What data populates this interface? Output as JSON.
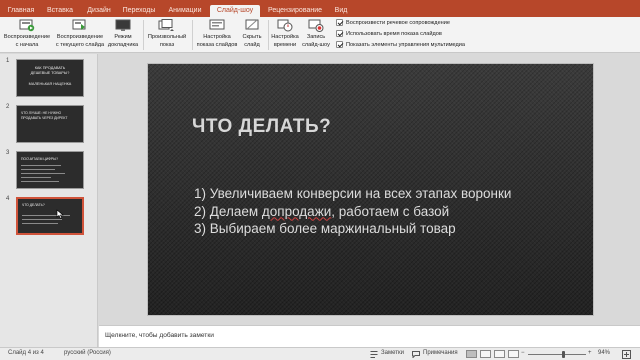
{
  "tabs": [
    "Главная",
    "Вставка",
    "Дизайн",
    "Переходы",
    "Анимации",
    "Слайд-шоу",
    "Рецензирование",
    "Вид"
  ],
  "active_tab": "Слайд-шоу",
  "ribbon": {
    "play_from_start": [
      "Воспроизведение",
      "с начала"
    ],
    "play_from_current": [
      "Воспроизведение",
      "с текущего слайда"
    ],
    "presenter_view": [
      "Режим",
      "докладчика"
    ],
    "custom_show": [
      "Произвольный",
      "показ"
    ],
    "setup_show": [
      "Настройка",
      "показа слайдов"
    ],
    "hide_slide": [
      "Скрыть",
      "слайд"
    ],
    "rehearse_timings": [
      "Настройка",
      "времени"
    ],
    "record_show": [
      "Запись",
      "слайд-шоу"
    ],
    "checkboxes": [
      {
        "label": "Воспроизвести речевое сопровождение",
        "checked": true
      },
      {
        "label": "Использовать время показа слайдов",
        "checked": true
      },
      {
        "label": "Показать элементы управления мультимедиа",
        "checked": true
      }
    ]
  },
  "slides": [
    {
      "number": "1",
      "lines": [
        "КАК ПРОДАВАТЬ",
        "ДЕШЕВЫЕ ТОВАРЫ?",
        "",
        "МАЛЕНЬКАЯ НАЦЕНКА"
      ]
    },
    {
      "number": "2",
      "lines": [
        "ЧТО ЛУЧШЕ: НЕ НУЖНО",
        "ПРОДАВАТЬ ЧЕРЕЗ ДИРЕКТ"
      ]
    },
    {
      "number": "3",
      "lines": [
        "ПОСЧИТАЕМ ЦИФРЫ?"
      ]
    },
    {
      "number": "4",
      "lines": [
        "ЧТО ДЕЛАТЬ?"
      ]
    }
  ],
  "current_slide": {
    "title": "ЧТО ДЕЛАТЬ?",
    "bullets": [
      {
        "before": "1) Увеличиваем конверсии на всех этапах воронки",
        "marked": "",
        "after": ""
      },
      {
        "before": "2) Делаем ",
        "marked": "допродажи",
        "after": ", работаем с базой"
      },
      {
        "before": "3) Выбираем более маржинальный товар",
        "marked": "",
        "after": ""
      }
    ]
  },
  "notes_placeholder": "Щелкните, чтобы добавить заметки",
  "status": {
    "slide_counter": "Слайд 4 из 4",
    "language": "русский (Россия)",
    "notes_label": "Заметки",
    "comments_label": "Примечания",
    "zoom_minus": "−",
    "zoom_plus": "+",
    "zoom": "94%",
    "zoom_level": 0.94
  },
  "colors": {
    "accent": "#b7472a",
    "selection": "#d0533a"
  }
}
